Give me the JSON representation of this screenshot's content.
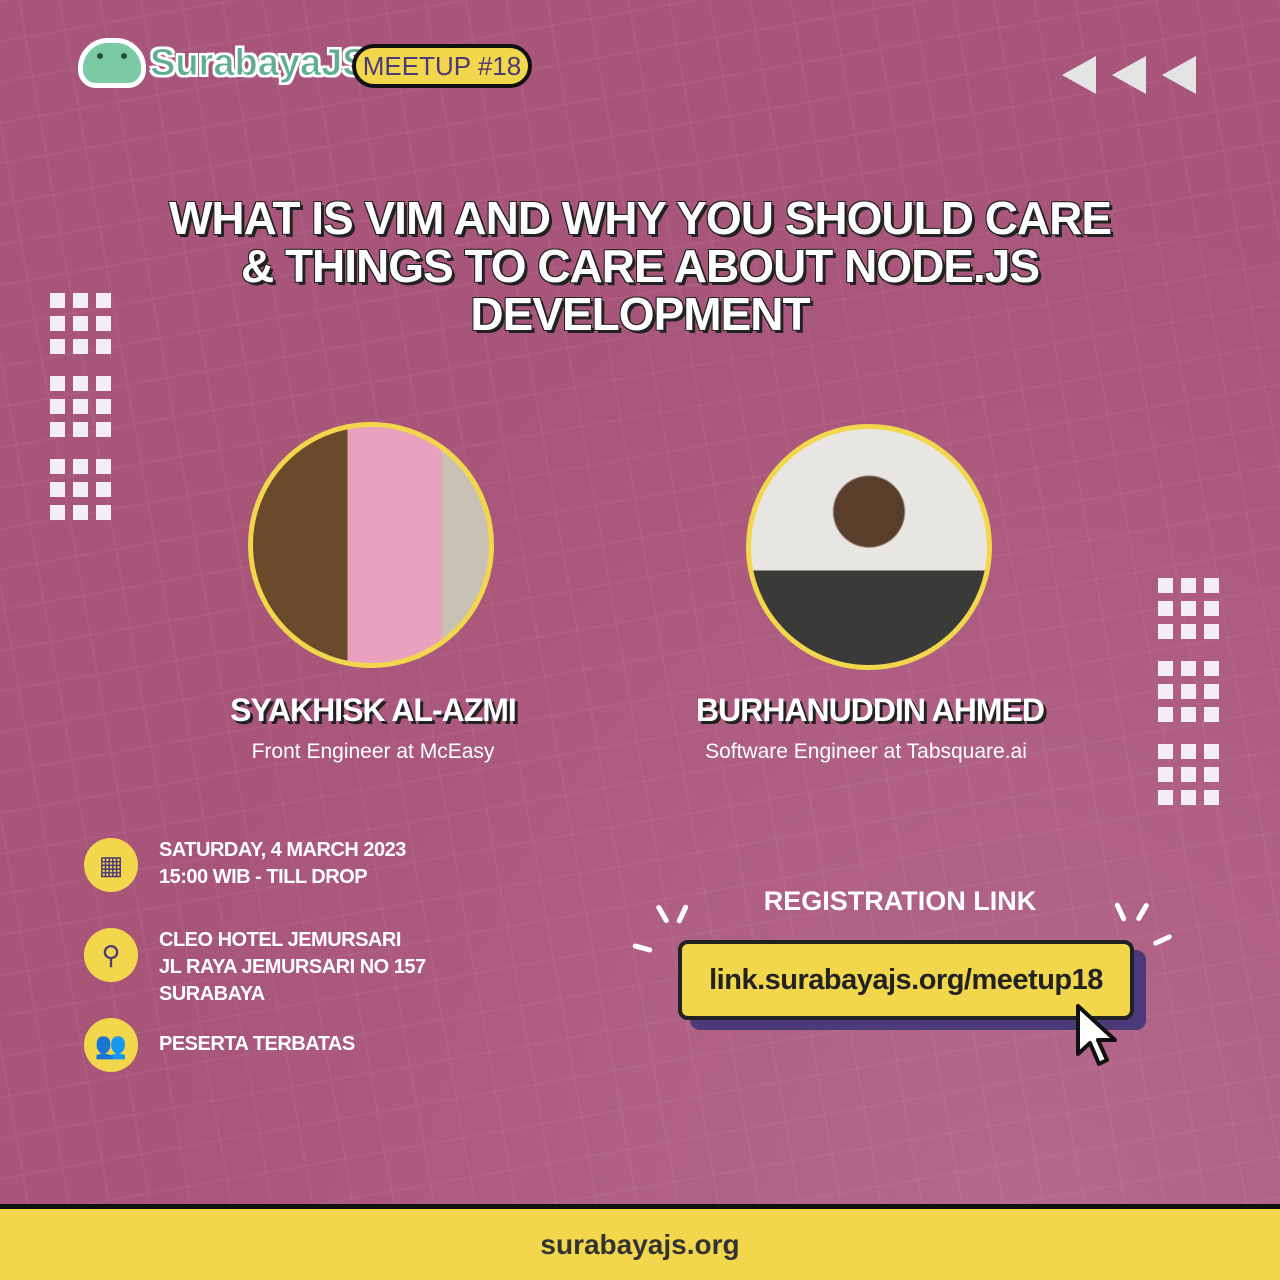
{
  "brand": {
    "name": "SurabayaJS",
    "badge": "MEETUP #18"
  },
  "title": "WHAT IS VIM AND WHY YOU SHOULD CARE & THINGS TO CARE ABOUT NODE.JS DEVELOPMENT",
  "speakers": [
    {
      "name": "SYAKHISK AL-AZMI",
      "role": "Front Engineer at McEasy"
    },
    {
      "name": "BURHANUDDIN AHMED",
      "role": "Software Engineer at Tabsquare.ai"
    }
  ],
  "details": {
    "date": "SATURDAY, 4 MARCH 2023",
    "time": "15:00 WIB - TILL DROP",
    "venue": "CLEO HOTEL JEMURSARI",
    "address": "JL RAYA JEMURSARI NO 157",
    "city": "SURABAYA",
    "capacity": "PESERTA TERBATAS"
  },
  "registration": {
    "label": "REGISTRATION LINK",
    "link": "link.surabayajs.org/meetup18"
  },
  "footer": {
    "site": "surabayajs.org"
  },
  "colors": {
    "background": "#a8557a",
    "accent": "#f2d64b",
    "icon": "#4a3a78"
  }
}
